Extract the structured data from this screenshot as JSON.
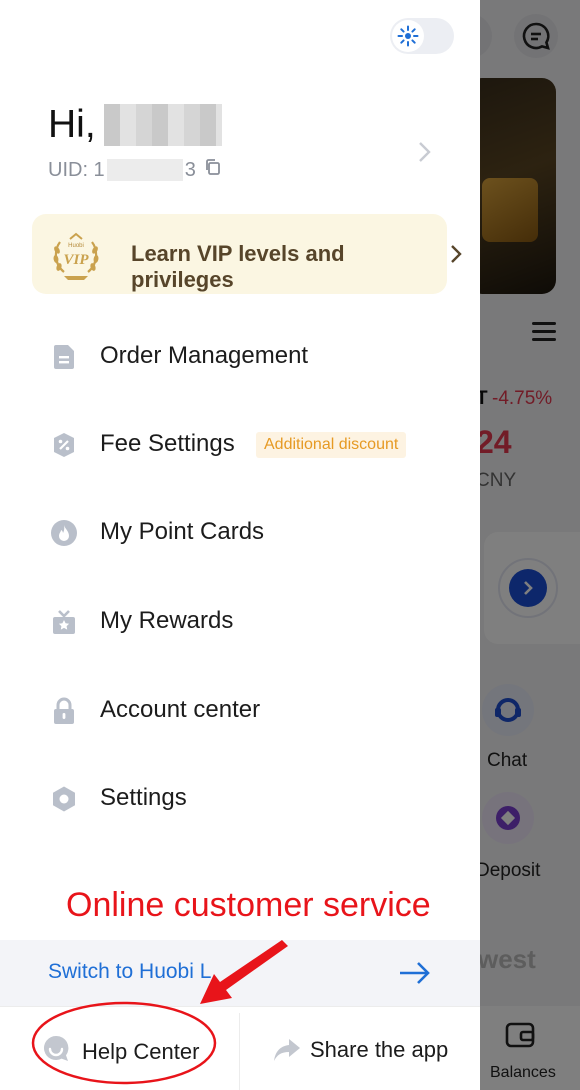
{
  "background_app": {
    "change_percent": "-4.75%",
    "change_prefix": "T",
    "price_partial": "24",
    "currency_partial": "CNY",
    "chat_label": "Chat",
    "deposit_label": "Deposit",
    "section_partial": "west",
    "balances_label": "Balances"
  },
  "drawer": {
    "greeting": "Hi,",
    "uid_prefix": "UID: 1",
    "uid_suffix": "3",
    "vip_banner": {
      "badge_text": "VIP",
      "badge_brand": "Huobi",
      "label": "Learn VIP levels and privileges"
    },
    "menu": [
      {
        "label": "Order Management",
        "icon": "document-icon"
      },
      {
        "label": "Fee Settings",
        "icon": "percent-tag-icon",
        "badge": "Additional discount"
      },
      {
        "label": "My Point Cards",
        "icon": "flame-icon"
      },
      {
        "label": "My Rewards",
        "icon": "gift-icon"
      },
      {
        "label": "Account center",
        "icon": "lock-icon"
      },
      {
        "label": "Settings",
        "icon": "hexagon-icon"
      }
    ],
    "switch_link": "Switch to Huobi L",
    "bottom": {
      "help_center": "Help Center",
      "share_app": "Share the app"
    }
  },
  "annotation": {
    "text": "Online customer service",
    "color": "#e8141a"
  },
  "colors": {
    "accent_blue": "#1f6fd6",
    "vip_bg": "#fbf6e2",
    "vip_text": "#57452a",
    "badge_orange": "#e69a24",
    "negative_red": "#e5384f"
  }
}
